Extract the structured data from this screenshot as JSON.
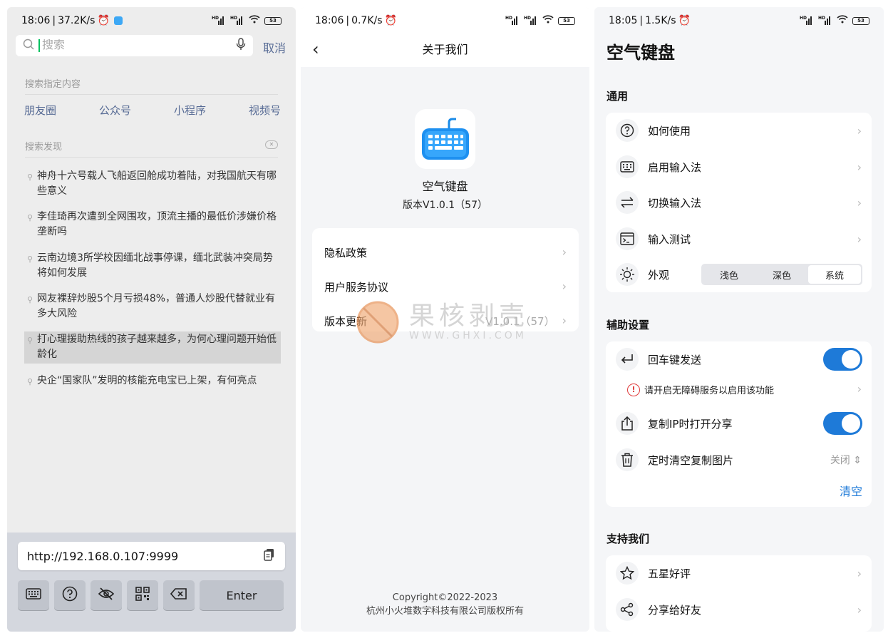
{
  "phone1": {
    "status": {
      "time": "18:06",
      "speed": "37.2K/s",
      "battery": "53"
    },
    "search": {
      "placeholder": "搜索",
      "cancel": "取消"
    },
    "specify_label": "搜索指定内容",
    "categories": [
      "朋友圈",
      "公众号",
      "小程序",
      "视频号"
    ],
    "discover_label": "搜索发现",
    "suggestions": [
      "神舟十六号载人飞船返回舱成功着陆，对我国航天有哪些意义",
      "李佳琦再次遭到全网围攻，顶流主播的最低价涉嫌价格垄断吗",
      "云南边境3所学校因缅北战事停课，缅北武装冲突局势将如何发展",
      "网友裸辞炒股5个月亏损48%，普通人炒股代替就业有多大风险",
      "打心理援助热线的孩子越来越多，为何心理问题开始低龄化",
      "央企“国家队”发明的核能充电宝已上架，有何亮点"
    ],
    "keyboard": {
      "url": "http://192.168.0.107:9999",
      "enter": "Enter"
    }
  },
  "phone2": {
    "status": {
      "time": "18:06",
      "speed": "0.7K/s",
      "battery": "53"
    },
    "title": "关于我们",
    "app_name": "空气键盘",
    "version": "版本V1.0.1（57）",
    "rows": [
      {
        "label": "隐私政策",
        "value": ""
      },
      {
        "label": "用户服务协议",
        "value": ""
      },
      {
        "label": "版本更新",
        "value": "V1.0.1（57）"
      }
    ],
    "copyright_line1": "Copyright©2022-2023",
    "copyright_line2": "杭州小火堆数字科技有限公司版权所有",
    "watermark": {
      "cn": "果核剥壳",
      "en": "WWW.GHXI.COM"
    }
  },
  "phone3": {
    "status": {
      "time": "18:05",
      "speed": "1.5K/s",
      "battery": "53"
    },
    "title": "空气键盘",
    "general": {
      "header": "通用",
      "items": [
        "如何使用",
        "启用输入法",
        "切换输入法",
        "输入测试"
      ],
      "appearance_label": "外观",
      "appearance_options": [
        "浅色",
        "深色",
        "系统"
      ],
      "appearance_selected": "系统"
    },
    "assist": {
      "header": "辅助设置",
      "enter_send": "回车键发送",
      "enter_send_on": true,
      "warning": "请开启无障碍服务以启用该功能",
      "copy_share": "复制IP时打开分享",
      "copy_share_on": true,
      "timer_label": "定时清空复制图片",
      "timer_value": "关闭",
      "clear": "清空"
    },
    "support": {
      "header": "支持我们",
      "rate": "五星好评",
      "share": "分享给好友"
    }
  },
  "colors": {
    "accent": "#1e7ad8",
    "wechat_link": "#576b95",
    "keyboard_bg": "#d4d7de"
  }
}
